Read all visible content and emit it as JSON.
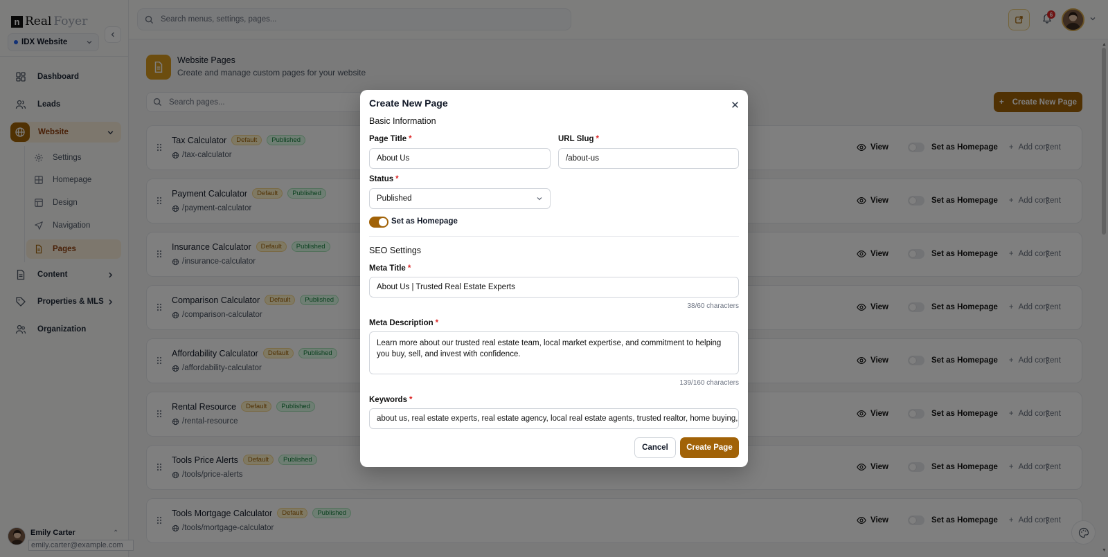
{
  "brand": {
    "logo_mark": "n",
    "logo_bold": "Real",
    "logo_light": "Foyer"
  },
  "site_selector": {
    "value": "IDX Website"
  },
  "sidebar": {
    "items": [
      {
        "label": "Dashboard",
        "icon": "dashboard-icon"
      },
      {
        "label": "Leads",
        "icon": "users-icon"
      },
      {
        "label": "Website",
        "icon": "globe-icon"
      },
      {
        "label": "Content",
        "icon": "document-icon"
      },
      {
        "label": "Properties & MLS",
        "icon": "tag-icon"
      },
      {
        "label": "Organization",
        "icon": "organization-icon"
      }
    ],
    "website_sub": [
      {
        "label": "Settings",
        "icon": "gear-icon"
      },
      {
        "label": "Homepage",
        "icon": "grid-icon"
      },
      {
        "label": "Design",
        "icon": "layout-icon"
      },
      {
        "label": "Navigation",
        "icon": "navigation-icon"
      },
      {
        "label": "Pages",
        "icon": "page-icon"
      }
    ],
    "user": {
      "name": "Emily Carter",
      "email": "emily.carter@example.com"
    }
  },
  "topbar": {
    "search_placeholder": "Search menus, settings, pages...",
    "notification_count": "6"
  },
  "main": {
    "title": "Website Pages",
    "subtitle": "Create and manage custom pages for your website",
    "search_placeholder": "Search pages...",
    "create_button": "Create New Page",
    "action_view": "View",
    "action_set_home": "Set as Homepage",
    "action_add": "Add content",
    "tag_default": "Default",
    "tag_published": "Published",
    "pages": [
      {
        "title": "Tax Calculator",
        "slug": "/tax-calculator"
      },
      {
        "title": "Payment Calculator",
        "slug": "/payment-calculator"
      },
      {
        "title": "Insurance Calculator",
        "slug": "/insurance-calculator"
      },
      {
        "title": "Comparison Calculator",
        "slug": "/comparison-calculator"
      },
      {
        "title": "Affordability Calculator",
        "slug": "/affordability-calculator"
      },
      {
        "title": "Rental Resource",
        "slug": "/rental-resource"
      },
      {
        "title": "Tools Price Alerts",
        "slug": "/tools/price-alerts"
      },
      {
        "title": "Tools Mortgage Calculator",
        "slug": "/tools/mortgage-calculator"
      }
    ]
  },
  "modal": {
    "title": "Create New Page",
    "basic_section": "Basic Information",
    "page_title_label": "Page Title",
    "page_title_value": "About Us",
    "url_slug_label": "URL Slug",
    "url_slug_value": "/about-us",
    "status_label": "Status",
    "status_value": "Published",
    "homepage_toggle_label": "Set as Homepage",
    "homepage_toggle_on": true,
    "seo_section": "SEO Settings",
    "meta_title_label": "Meta Title",
    "meta_title_value": "About Us | Trusted Real Estate Experts",
    "meta_title_counter": "38/60 characters",
    "meta_desc_label": "Meta Description",
    "meta_desc_value": "Learn more about our trusted real estate team, local market expertise, and commitment to helping you buy, sell, and invest with confidence.",
    "meta_desc_counter": "139/160 characters",
    "keywords_label": "Keywords",
    "keywords_value": "about us, real estate experts, real estate agency, local real estate agents, trusted realtor, home buying, ho",
    "cancel": "Cancel",
    "create": "Create Page",
    "required_mark": "*"
  },
  "colors": {
    "accent": "#a16207",
    "accent_light": "#fbeedb",
    "danger": "#dc2626",
    "success": "#15803d"
  }
}
